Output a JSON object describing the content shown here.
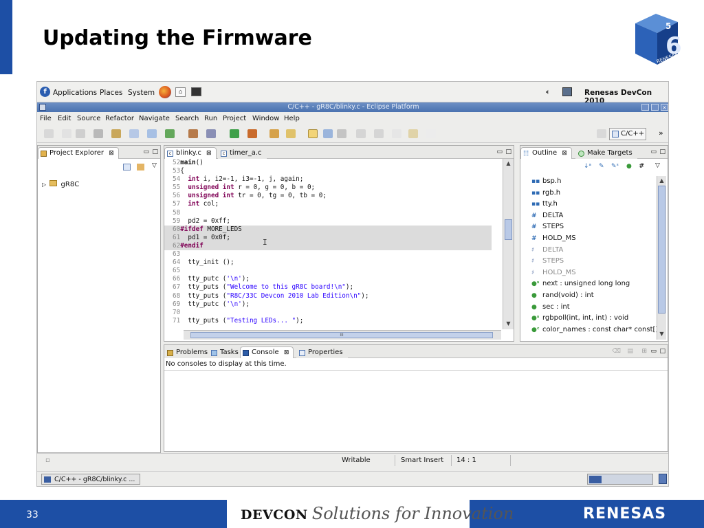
{
  "slide": {
    "title": "Updating the Firmware",
    "page_number": "33",
    "footer_brand": "DEVCON",
    "footer_slogan": "Solutions for Innovation",
    "footer_company": "RENESAS",
    "logo_text": "RENESAS",
    "logo_digit": "6",
    "logo_corner": "5"
  },
  "gnome": {
    "applications": "Applications",
    "places": "Places",
    "system": "System",
    "right_title": "Renesas DevCon 2010"
  },
  "window": {
    "title": "C/C++ - gR8C/blinky.c - Eclipse Platform"
  },
  "menu": [
    "File",
    "Edit",
    "Source",
    "Refactor",
    "Navigate",
    "Search",
    "Run",
    "Project",
    "Window",
    "Help"
  ],
  "perspective": {
    "label": "C/C++",
    "more": "»"
  },
  "project_explorer": {
    "tab": "Project Explorer",
    "items": [
      "gR8C"
    ]
  },
  "editor": {
    "tabs": [
      "blinky.c",
      "timer_a.c"
    ],
    "lines": [
      {
        "n": "52",
        "t": "main()",
        "k": "main"
      },
      {
        "n": "53",
        "t": "{"
      },
      {
        "n": "54",
        "t": "  int i, i2=-1, i3=-1, j, again;"
      },
      {
        "n": "55",
        "t": "  unsigned int r = 0, g = 0, b = 0;"
      },
      {
        "n": "56",
        "t": "  unsigned int tr = 0, tg = 0, tb = 0;"
      },
      {
        "n": "57",
        "t": "  int col;"
      },
      {
        "n": "58",
        "t": ""
      },
      {
        "n": "59",
        "t": "  pd2 = 0xff;"
      },
      {
        "n": "60",
        "t": "#ifdef MORE_LEDS"
      },
      {
        "n": "61",
        "t": "  pd1 = 0x0f;"
      },
      {
        "n": "62",
        "t": "#endif"
      },
      {
        "n": "63",
        "t": ""
      },
      {
        "n": "64",
        "t": "  tty_init ();"
      },
      {
        "n": "65",
        "t": ""
      },
      {
        "n": "66",
        "t": "  tty_putc ('\\n');"
      },
      {
        "n": "67",
        "t": "  tty_puts (\"Welcome to this gR8C board!\\n\");"
      },
      {
        "n": "68",
        "t": "  tty_puts (\"R8C/33C Devcon 2010 Lab Edition\\n\");"
      },
      {
        "n": "69",
        "t": "  tty_putc ('\\n');"
      },
      {
        "n": "70",
        "t": ""
      },
      {
        "n": "71",
        "t": "  tty_puts (\"Testing LEDs... \");"
      }
    ],
    "scroll_mark": "III"
  },
  "outline": {
    "tabs": [
      "Outline",
      "Make Targets"
    ],
    "items": [
      {
        "icon": "▪▪",
        "label": "bsp.h",
        "muted": false
      },
      {
        "icon": "▪▪",
        "label": "rgb.h",
        "muted": false
      },
      {
        "icon": "▪▪",
        "label": "tty.h",
        "muted": false
      },
      {
        "icon": "#",
        "label": "DELTA",
        "muted": false
      },
      {
        "icon": "#",
        "label": "STEPS",
        "muted": false
      },
      {
        "icon": "#",
        "label": "HOLD_MS",
        "muted": false
      },
      {
        "icon": "♯",
        "label": "DELTA",
        "muted": true
      },
      {
        "icon": "♯",
        "label": "STEPS",
        "muted": true
      },
      {
        "icon": "♯",
        "label": "HOLD_MS",
        "muted": true
      },
      {
        "icon": "●ˢ",
        "label": "next : unsigned long long",
        "muted": false
      },
      {
        "icon": "●",
        "label": "rand(void) : int",
        "muted": false
      },
      {
        "icon": "●",
        "label": "sec : int",
        "muted": false
      },
      {
        "icon": "●ˢ",
        "label": "rgbpoll(int, int, int) : void",
        "muted": false
      },
      {
        "icon": "●ᶜ",
        "label": "color_names : const char* const[]",
        "muted": false
      }
    ]
  },
  "console": {
    "tabs": [
      "Problems",
      "Tasks",
      "Console",
      "Properties"
    ],
    "message": "No consoles to display at this time."
  },
  "status": {
    "writable": "Writable",
    "insert": "Smart Insert",
    "position": "14 : 1"
  },
  "taskbar": {
    "item": "C/C++ - gR8C/blinky.c ..."
  },
  "colors": {
    "brand_blue": "#1d4fa5",
    "title_bar": "#4a72b0",
    "keyword": "#7f0055",
    "string": "#2a00ff"
  }
}
